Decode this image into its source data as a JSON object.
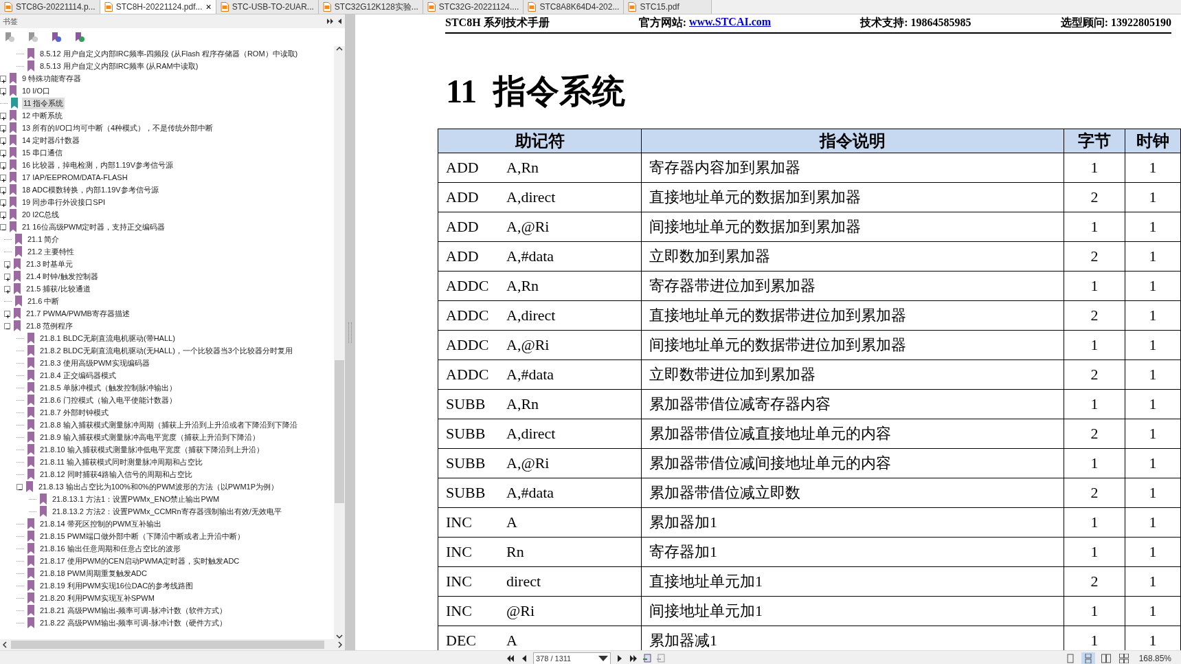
{
  "tabs": [
    {
      "label": "STC8G-20221114.p...",
      "selected": false
    },
    {
      "label": "STC8H-20221124.pdf...",
      "selected": true,
      "close": "×"
    },
    {
      "label": "STC-USB-TO-2UAR...",
      "selected": false
    },
    {
      "label": "STC32G12K128实验...",
      "selected": false
    },
    {
      "label": "STC32G-20221124....",
      "selected": false
    },
    {
      "label": "STC8A8K64D4-202...",
      "selected": false
    },
    {
      "label": "STC15.pdf",
      "selected": false
    }
  ],
  "sidebar": {
    "title": "书签",
    "tree": [
      {
        "children": [
          {
            "children": [
              {
                "label": "8.5.12 用户自定义内部IRC频率-四频段 (从Flash 程序存储器（ROM）中读取)",
                "selected": false
              },
              {
                "label": "8.5.13 用户自定义内部IRC频率 (从RAM中读取)",
                "selected": false
              }
            ]
          }
        ]
      },
      {
        "label": "9 特殊功能寄存器",
        "selected": false,
        "expanded": false
      },
      {
        "label": "10 I/O口",
        "selected": false,
        "expanded": false
      },
      {
        "label": "11 指令系统",
        "selected": true
      },
      {
        "label": "12 中断系统",
        "selected": false,
        "expanded": false
      },
      {
        "label": "13 所有的I/O口均可中断（4种模式），不是传统外部中断",
        "selected": false,
        "expanded": false
      },
      {
        "label": "14 定时器/计数器",
        "selected": false,
        "expanded": false
      },
      {
        "label": "15 串口通信",
        "selected": false,
        "expanded": false
      },
      {
        "label": "16 比较器，掉电检测，内部1.19V参考信号源",
        "selected": false,
        "expanded": false
      },
      {
        "label": "17 IAP/EEPROM/DATA-FLASH",
        "selected": false,
        "expanded": false
      },
      {
        "label": "18 ADC模数转换，内部1.19V参考信号源",
        "selected": false,
        "expanded": false
      },
      {
        "label": "19 同步串行外设接口SPI",
        "selected": false,
        "expanded": false
      },
      {
        "label": "20 I2C总线",
        "selected": false,
        "expanded": false
      },
      {
        "label": "21 16位高级PWM定时器，支持正交编码器",
        "selected": false,
        "expanded": true,
        "children": [
          {
            "label": "21.1 简介",
            "selected": false
          },
          {
            "label": "21.2 主要特性",
            "selected": false
          },
          {
            "label": "21.3 时基单元",
            "selected": false,
            "expanded": false
          },
          {
            "label": "21.4 时钟/触发控制器",
            "selected": false,
            "expanded": false
          },
          {
            "label": "21.5 捕获/比较通道",
            "selected": false,
            "expanded": false
          },
          {
            "label": "21.6 中断",
            "selected": false
          },
          {
            "label": "21.7 PWMA/PWMB寄存器描述",
            "selected": false,
            "expanded": false
          },
          {
            "label": "21.8 范例程序",
            "selected": false,
            "expanded": true,
            "children": [
              {
                "label": "21.8.1 BLDC无刷直流电机驱动(带HALL)",
                "selected": false
              },
              {
                "label": "21.8.2 BLDC无刷直流电机驱动(无HALL)，一个比较器当3个比较器分时复用",
                "selected": false
              },
              {
                "label": "21.8.3 使用高级PWM实现编码器",
                "selected": false
              },
              {
                "label": "21.8.4 正交编码器模式",
                "selected": false
              },
              {
                "label": "21.8.5 单脉冲模式（触发控制脉冲输出）",
                "selected": false
              },
              {
                "label": "21.8.6 门控模式（输入电平使能计数器）",
                "selected": false
              },
              {
                "label": "21.8.7 外部时钟模式",
                "selected": false
              },
              {
                "label": "21.8.8 输入捕获模式测量脉冲周期（捕获上升沿到上升沿或者下降沿到下降沿",
                "selected": false
              },
              {
                "label": "21.8.9 输入捕获模式测量脉冲高电平宽度（捕获上升沿到下降沿）",
                "selected": false
              },
              {
                "label": "21.8.10 输入捕获模式测量脉冲低电平宽度（捕获下降沿到上升沿）",
                "selected": false
              },
              {
                "label": "21.8.11 输入捕获模式同时测量脉冲周期和占空比",
                "selected": false
              },
              {
                "label": "21.8.12 同时捕获4路输入信号的周期和占空比",
                "selected": false
              },
              {
                "label": "21.8.13 输出占空比为100%和0%的PWM波形的方法（以PWM1P为例）",
                "selected": false,
                "expanded": true,
                "children": [
                  {
                    "label": "21.8.13.1 方法1：设置PWMx_ENO禁止输出PWM",
                    "selected": false
                  },
                  {
                    "label": "21.8.13.2 方法2：设置PWMx_CCMRn寄存器强制输出有效/无效电平",
                    "selected": false
                  }
                ]
              },
              {
                "label": "21.8.14 带死区控制的PWM互补输出",
                "selected": false
              },
              {
                "label": "21.8.15 PWM端口做外部中断（下降沿中断或者上升沿中断）",
                "selected": false
              },
              {
                "label": "21.8.16 输出任意周期和任意占空比的波形",
                "selected": false
              },
              {
                "label": "21.8.17 使用PWM的CEN启动PWMA定时器，实时触发ADC",
                "selected": false
              },
              {
                "label": "21.8.18 PWM周期重复触发ADC",
                "selected": false
              },
              {
                "label": "21.8.19 利用PWM实现16位DAC的参考线路图",
                "selected": false
              },
              {
                "label": "21.8.20 利用PWM实现互补SPWM",
                "selected": false
              },
              {
                "label": "21.8.21 高级PWM输出-频率可调-脉冲计数（软件方式）",
                "selected": false
              },
              {
                "label": "21.8.22 高级PWM输出-频率可调-脉冲计数（硬件方式）",
                "selected": false
              }
            ]
          }
        ]
      }
    ]
  },
  "document": {
    "header": {
      "manual": "STC8H 系列技术手册",
      "site_label": "官方网站:",
      "site_link": "www.STCAI.com",
      "support": "技术支持: 19864585985",
      "advisor": "选型顾问: 13922805190"
    },
    "heading": "11  指令系统",
    "table": {
      "columns": [
        "助记符",
        "指令说明",
        "字节",
        "时钟"
      ],
      "rows": [
        {
          "mnemonic": "ADD",
          "operand": "A,Rn",
          "description": "寄存器内容加到累加器",
          "bytes": "1",
          "cycles": "1"
        },
        {
          "mnemonic": "ADD",
          "operand": "A,direct",
          "description": "直接地址单元的数据加到累加器",
          "bytes": "2",
          "cycles": "1"
        },
        {
          "mnemonic": "ADD",
          "operand": "A,@Ri",
          "description": "间接地址单元的数据加到累加器",
          "bytes": "1",
          "cycles": "1"
        },
        {
          "mnemonic": "ADD",
          "operand": "A,#data",
          "description": "立即数加到累加器",
          "bytes": "2",
          "cycles": "1"
        },
        {
          "mnemonic": "ADDC",
          "operand": "A,Rn",
          "description": "寄存器带进位加到累加器",
          "bytes": "1",
          "cycles": "1"
        },
        {
          "mnemonic": "ADDC",
          "operand": "A,direct",
          "description": "直接地址单元的数据带进位加到累加器",
          "bytes": "2",
          "cycles": "1"
        },
        {
          "mnemonic": "ADDC",
          "operand": "A,@Ri",
          "description": "间接地址单元的数据带进位加到累加器",
          "bytes": "1",
          "cycles": "1"
        },
        {
          "mnemonic": "ADDC",
          "operand": "A,#data",
          "description": "立即数带进位加到累加器",
          "bytes": "2",
          "cycles": "1"
        },
        {
          "mnemonic": "SUBB",
          "operand": "A,Rn",
          "description": "累加器带借位减寄存器内容",
          "bytes": "1",
          "cycles": "1"
        },
        {
          "mnemonic": "SUBB",
          "operand": "A,direct",
          "description": "累加器带借位减直接地址单元的内容",
          "bytes": "2",
          "cycles": "1"
        },
        {
          "mnemonic": "SUBB",
          "operand": "A,@Ri",
          "description": "累加器带借位减间接地址单元的内容",
          "bytes": "1",
          "cycles": "1"
        },
        {
          "mnemonic": "SUBB",
          "operand": "A,#data",
          "description": "累加器带借位减立即数",
          "bytes": "2",
          "cycles": "1"
        },
        {
          "mnemonic": "INC",
          "operand": "A",
          "description": "累加器加1",
          "bytes": "1",
          "cycles": "1"
        },
        {
          "mnemonic": "INC",
          "operand": "Rn",
          "description": "寄存器加1",
          "bytes": "1",
          "cycles": "1"
        },
        {
          "mnemonic": "INC",
          "operand": "direct",
          "description": "直接地址单元加1",
          "bytes": "2",
          "cycles": "1"
        },
        {
          "mnemonic": "INC",
          "operand": "@Ri",
          "description": "间接地址单元加1",
          "bytes": "1",
          "cycles": "1"
        },
        {
          "mnemonic": "DEC",
          "operand": "A",
          "description": "累加器减1",
          "bytes": "1",
          "cycles": "1"
        }
      ]
    }
  },
  "status_bar": {
    "page": "378 / 1311",
    "zoom": "168.85%",
    "view_modes": [
      {
        "selected": false
      },
      {
        "selected": true
      },
      {
        "selected": false
      },
      {
        "selected": false
      }
    ]
  }
}
